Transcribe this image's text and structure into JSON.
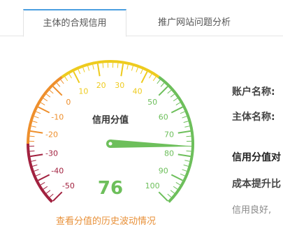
{
  "tabs": [
    {
      "label": "主体的合规信用",
      "active": true
    },
    {
      "label": "推广网站问题分析",
      "active": false
    }
  ],
  "gauge": {
    "title": "信用分值",
    "score": 76,
    "score_display": "76",
    "min": -50,
    "max": 100,
    "tick_labels": [
      "-50",
      "-40",
      "-30",
      "-20",
      "-10",
      "0",
      "10",
      "20",
      "30",
      "40",
      "50",
      "60",
      "70",
      "80",
      "90",
      "100"
    ],
    "bands": [
      {
        "from": -50,
        "to": -25,
        "color": "#a2213f"
      },
      {
        "from": -25,
        "to": 5,
        "color": "#ee8f2c"
      },
      {
        "from": 5,
        "to": 45,
        "color": "#eecb1e"
      },
      {
        "from": 45,
        "to": 100,
        "color": "#6dbf5b"
      }
    ],
    "needle_color": "#6dbf5b",
    "score_color": "#6dbf5b"
  },
  "history_link": "查看分值的历史波动情况",
  "info": {
    "account_label": "账户名称:",
    "entity_label": "主体名称:",
    "score_desc_title": "信用分值对",
    "cost_text": "成本提升比",
    "good_text": "信用良好,"
  }
}
